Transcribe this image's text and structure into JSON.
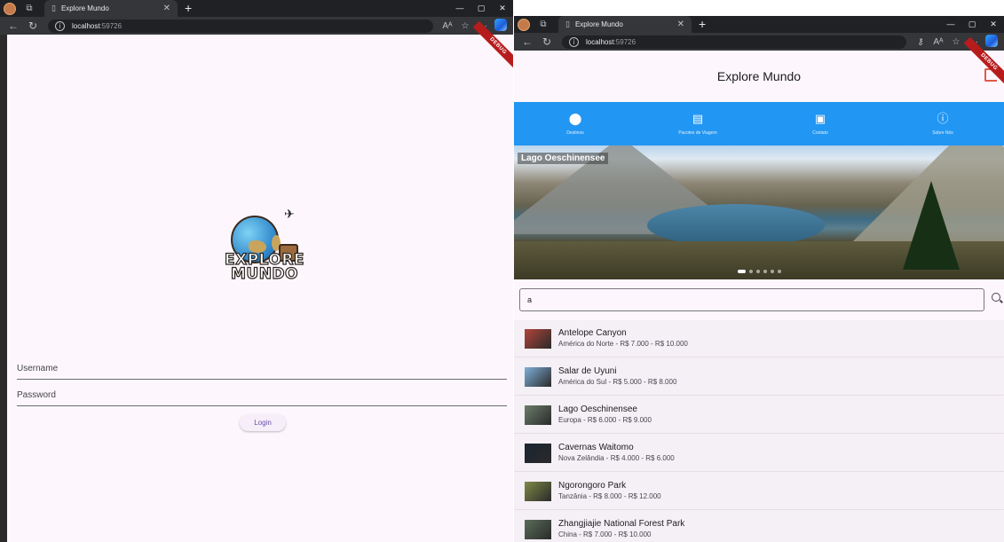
{
  "left_window": {
    "browser": {
      "tab_title": "Explore Mundo",
      "url_host": "localhost",
      "url_port": ":59726"
    },
    "app": {
      "debug_banner": "DEBUG",
      "logo": {
        "line1": "EXPLORE",
        "line2": "MUNDO"
      },
      "username_label": "Username",
      "password_label": "Password",
      "login_label": "Login"
    }
  },
  "right_window": {
    "browser": {
      "tab_title": "Explore Mundo",
      "url_host": "localhost",
      "url_port": ":59726"
    },
    "app": {
      "title": "Explore Mundo",
      "debug_banner": "DEBUG",
      "nav": [
        {
          "label": "Destinos",
          "icon": "location-pin-icon"
        },
        {
          "label": "Pacotes de Viagem",
          "icon": "briefcase-icon"
        },
        {
          "label": "Contato",
          "icon": "contact-card-icon"
        },
        {
          "label": "Sobre Nós",
          "icon": "info-icon"
        }
      ],
      "carousel": {
        "caption": "Lago Oeschinensee",
        "dot_count": 6,
        "active_index": 0
      },
      "search": {
        "value": "a"
      },
      "destinations": [
        {
          "name": "Antelope Canyon",
          "details": "América do Norte - R$ 7.000 - R$ 10.000",
          "thumb_color": "#b2453a"
        },
        {
          "name": "Salar de Uyuni",
          "details": "América do Sul - R$ 5.000 - R$ 8.000",
          "thumb_color": "#7fb0d9"
        },
        {
          "name": "Lago Oeschinensee",
          "details": "Europa - R$ 6.000 - R$ 9.000",
          "thumb_color": "#6b7d6a"
        },
        {
          "name": "Cavernas Waitomo",
          "details": "Nova Zelândia - R$ 4.000 - R$ 6.000",
          "thumb_color": "#1b2431"
        },
        {
          "name": "Ngorongoro Park",
          "details": "Tanzânia - R$ 8.000 - R$ 12.000",
          "thumb_color": "#7e8a46"
        },
        {
          "name": "Zhangjiajie National Forest Park",
          "details": "China - R$ 7.000 - R$ 10.000",
          "thumb_color": "#5a6d5a"
        }
      ]
    }
  }
}
